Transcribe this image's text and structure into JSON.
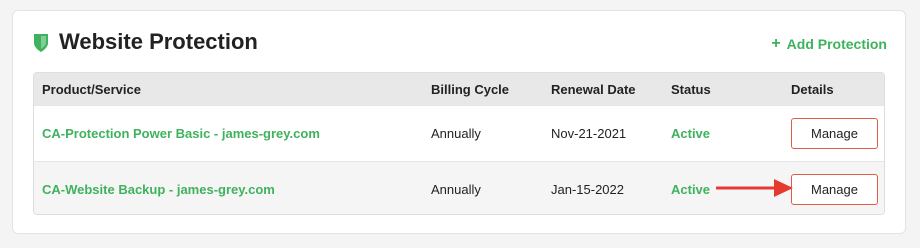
{
  "section": {
    "title": "Website Protection",
    "add_link": "Add Protection",
    "add_icon": "+"
  },
  "table": {
    "headers": {
      "product": "Product/Service",
      "billing": "Billing Cycle",
      "renewal": "Renewal Date",
      "status": "Status",
      "details": "Details"
    },
    "rows": [
      {
        "product": "CA-Protection Power Basic - james-grey.com",
        "billing": "Annually",
        "renewal": "Nov-21-2021",
        "status": "Active",
        "action": "Manage"
      },
      {
        "product": "CA-Website Backup - james-grey.com",
        "billing": "Annually",
        "renewal": "Jan-15-2022",
        "status": "Active",
        "action": "Manage"
      }
    ]
  },
  "colors": {
    "accent_green": "#3fb25d",
    "button_border": "#e25b45",
    "annotation_arrow": "#e53a2f"
  },
  "icons": {
    "section_icon": "shield-icon",
    "annotation": "red-arrow-icon"
  }
}
